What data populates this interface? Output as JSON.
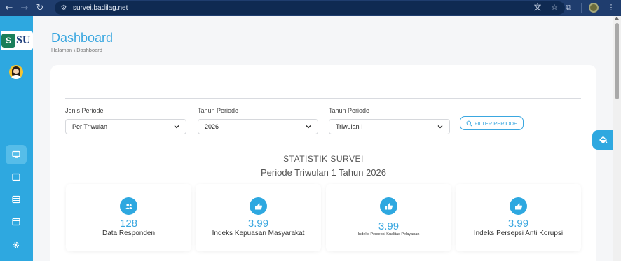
{
  "browser": {
    "url": "survei.badilag.net"
  },
  "sidebar": {
    "logo_text": "SU",
    "items": [
      {
        "icon": "monitor-icon",
        "active": true
      },
      {
        "icon": "table-icon",
        "active": false
      },
      {
        "icon": "table-icon",
        "active": false
      },
      {
        "icon": "table-icon",
        "active": false
      },
      {
        "icon": "gear-icon",
        "active": false
      }
    ]
  },
  "page": {
    "title": "Dashboard",
    "breadcrumb": "Halaman \\ Dashboard"
  },
  "filters": {
    "jenis_label": "Jenis Periode",
    "jenis_value": "Per Triwulan",
    "tahun_label": "Tahun Periode",
    "tahun_value": "2026",
    "triwulan_label": "Tahun Periode",
    "triwulan_value": "Triwulan I",
    "filter_button": "FILTER PERIODE"
  },
  "stats": {
    "title": "STATISTIK SURVEI",
    "subtitle": "Periode Triwulan 1 Tahun 2026",
    "cards": [
      {
        "value": "128",
        "label": "Data Responden",
        "icon": "users-icon"
      },
      {
        "value": "3.99",
        "label": "Indeks Kepuasan Masyarakat",
        "icon": "thumbs-up-icon"
      },
      {
        "value": "3.99",
        "label": "Indeks Persepsi Kualitas Pelayanan",
        "icon": "thumbs-up-icon"
      },
      {
        "value": "3.99",
        "label": "Indeks Persepsi Anti Korupsi",
        "icon": "thumbs-up-icon"
      }
    ]
  },
  "colors": {
    "accent": "#2ea8e0",
    "chrome": "#1f3d6e"
  }
}
